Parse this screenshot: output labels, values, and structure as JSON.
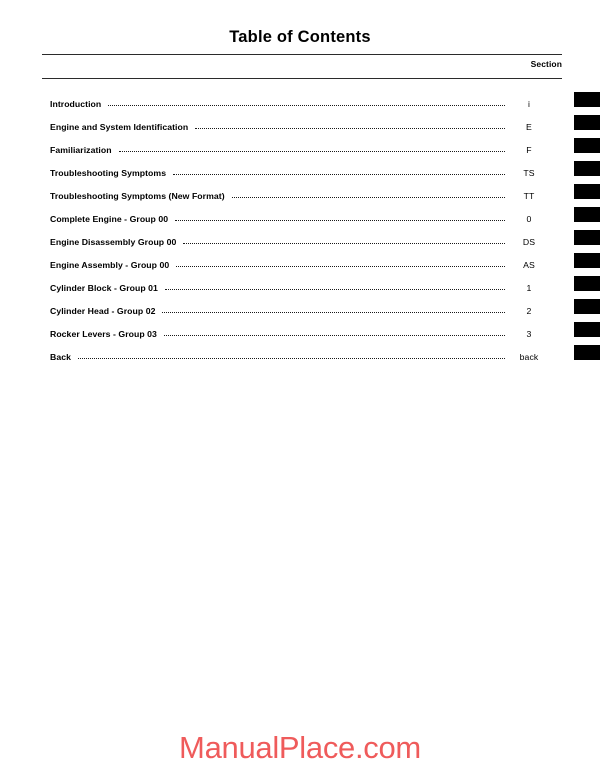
{
  "document": {
    "title": "Table of Contents",
    "section_column_header": "Section"
  },
  "toc": {
    "entries": [
      {
        "label": "Introduction",
        "section": "i"
      },
      {
        "label": "Engine and System Identification",
        "section": "E"
      },
      {
        "label": "Familiarization",
        "section": "F"
      },
      {
        "label": "Troubleshooting Symptoms",
        "section": "TS"
      },
      {
        "label": "Troubleshooting Symptoms (New Format)",
        "section": "TT"
      },
      {
        "label": "Complete Engine - Group 00",
        "section": "0"
      },
      {
        "label": "Engine Disassembly Group 00",
        "section": "DS"
      },
      {
        "label": "Engine Assembly - Group 00",
        "section": "AS"
      },
      {
        "label": "Cylinder Block - Group 01",
        "section": "1"
      },
      {
        "label": "Cylinder Head - Group 02",
        "section": "2"
      },
      {
        "label": "Rocker Levers - Group 03",
        "section": "3"
      },
      {
        "label": "Back",
        "section": "back"
      }
    ]
  },
  "tabs": {
    "count": 12,
    "color": "#000000"
  },
  "watermark": {
    "text": "ManualPlace.com",
    "color": "#ef5b5b"
  }
}
